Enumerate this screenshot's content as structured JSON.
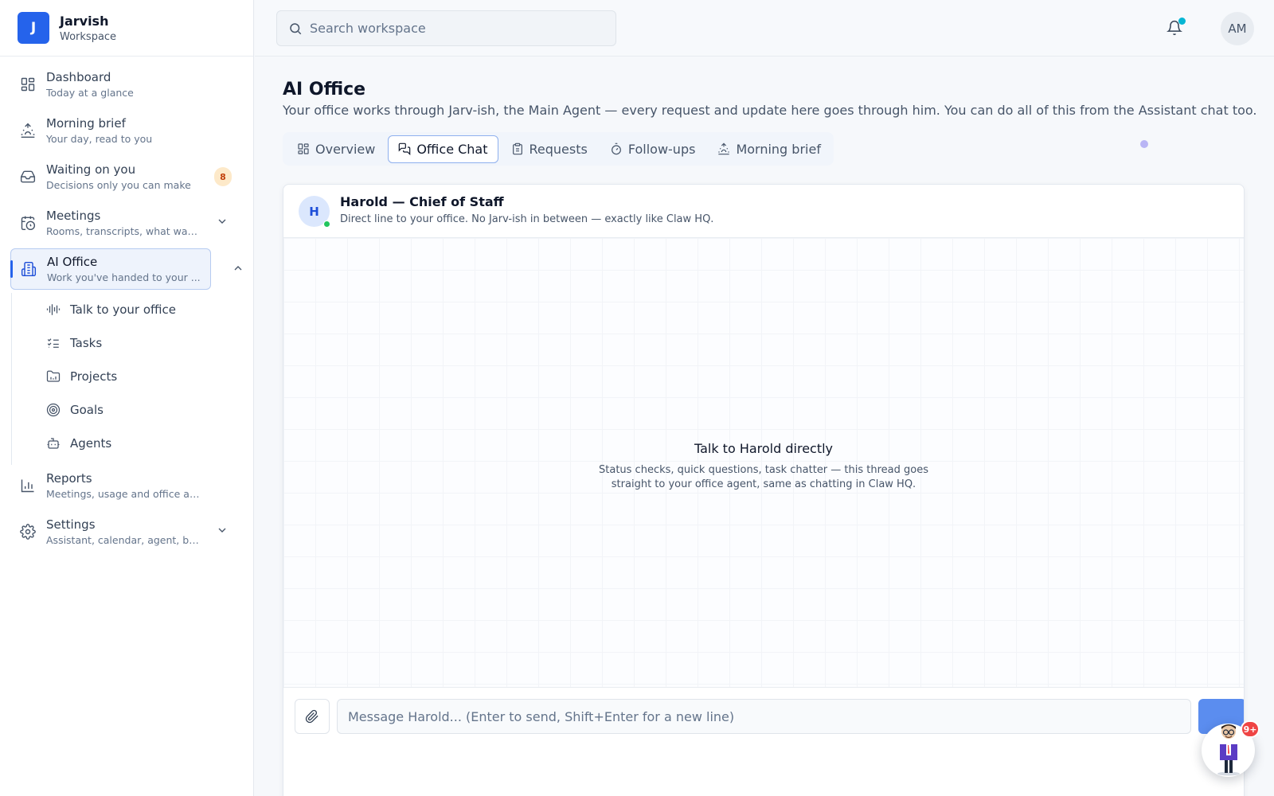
{
  "brand": {
    "initial": "J",
    "name": "Jarvish",
    "sub": "Workspace"
  },
  "search": {
    "placeholder": "Search workspace"
  },
  "user": {
    "initials": "AM"
  },
  "nav": [
    {
      "title": "Dashboard",
      "sub": "Today at a glance",
      "icon": "dashboard-icon"
    },
    {
      "title": "Morning brief",
      "sub": "Your day, read to you",
      "icon": "sunrise-icon"
    },
    {
      "title": "Waiting on you",
      "sub": "Decisions only you can make",
      "icon": "inbox-icon",
      "badge": "8"
    },
    {
      "title": "Meetings",
      "sub": "Rooms, transcripts, what was...",
      "icon": "calendar-clock-icon"
    },
    {
      "title": "AI Office",
      "sub": "Work you've handed to your ...",
      "icon": "building-icon"
    },
    {
      "title": "Reports",
      "sub": "Meetings, usage and office activity",
      "icon": "bar-chart-icon"
    },
    {
      "title": "Settings",
      "sub": "Assistant, calendar, agent, bil...",
      "icon": "gear-icon"
    }
  ],
  "subnav": [
    {
      "label": "Talk to your office",
      "icon": "audio-wave-icon"
    },
    {
      "label": "Tasks",
      "icon": "checklist-icon"
    },
    {
      "label": "Projects",
      "icon": "folder-icon"
    },
    {
      "label": "Goals",
      "icon": "target-icon"
    },
    {
      "label": "Agents",
      "icon": "robot-icon"
    }
  ],
  "page": {
    "title": "AI Office",
    "description": "Your office works through Jarv-ish, the Main Agent — every request and update here goes through him. You can do all of this from the Assistant chat too."
  },
  "tabs": [
    {
      "label": "Overview",
      "icon": "grid-icon"
    },
    {
      "label": "Office Chat",
      "icon": "chat-icon",
      "active": true
    },
    {
      "label": "Requests",
      "icon": "clipboard-icon"
    },
    {
      "label": "Follow-ups",
      "icon": "timer-icon"
    },
    {
      "label": "Morning brief",
      "icon": "sunrise-icon"
    }
  ],
  "chat": {
    "agent_initial": "H",
    "agent_name": "Harold — Chief of Staff",
    "agent_sub": "Direct line to your office. No Jarv-ish in between — exactly like Claw HQ.",
    "empty_title": "Talk to Harold directly",
    "empty_text": "Status checks, quick questions, task chatter — this thread goes straight to your office agent, same as chatting in Claw HQ.",
    "placeholder": "Message Harold... (Enter to send, Shift+Enter for a new line)"
  },
  "assistant_fab": {
    "badge": "9+"
  },
  "colors": {
    "accent": "#2563eb",
    "online": "#22c55e",
    "notify": "#06b6d4",
    "badge_red": "#ef4444"
  }
}
